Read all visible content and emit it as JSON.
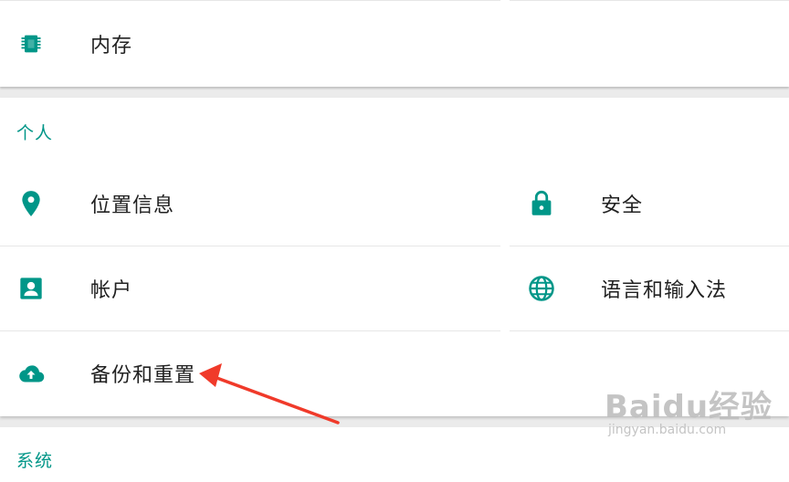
{
  "top_section": {
    "items": [
      {
        "label": "内存",
        "icon": "memory-chip-icon"
      }
    ]
  },
  "personal_section": {
    "header": "个人",
    "items": [
      {
        "label": "位置信息",
        "icon": "location-pin-icon"
      },
      {
        "label": "安全",
        "icon": "lock-icon"
      },
      {
        "label": "帐户",
        "icon": "account-box-icon"
      },
      {
        "label": "语言和输入法",
        "icon": "globe-icon"
      },
      {
        "label": "备份和重置",
        "icon": "cloud-upload-icon"
      }
    ]
  },
  "system_section": {
    "header": "系统"
  },
  "watermark": {
    "main": "Baidu经验",
    "sub": "jingyan.baidu.com"
  },
  "colors": {
    "accent": "#009688",
    "annotation_arrow": "#f03a2a"
  }
}
